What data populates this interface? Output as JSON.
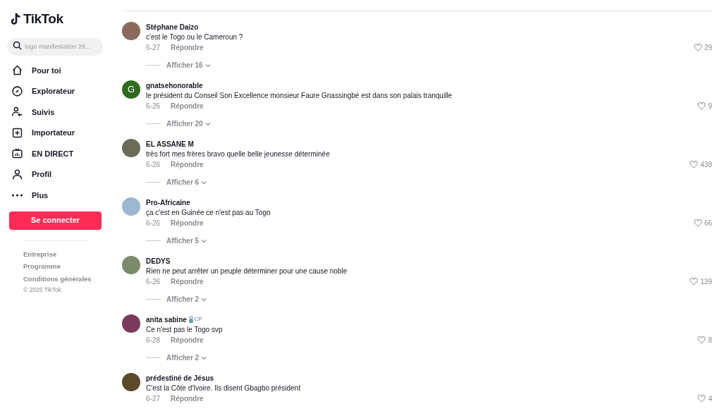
{
  "sidebar": {
    "logo": "TikTok",
    "search": {
      "placeholder": "togo manifestation 28..."
    },
    "nav": [
      {
        "label": "Pour toi"
      },
      {
        "label": "Explorateur"
      },
      {
        "label": "Suivis"
      },
      {
        "label": "Importateur"
      },
      {
        "label": "EN DIRECT"
      },
      {
        "label": "Profil"
      },
      {
        "label": "Plus"
      }
    ],
    "login_button": "Se connecter",
    "footer_links": [
      "Entreprise",
      "Programme",
      "Conditions générales"
    ],
    "copyright": "© 2025 TikTok"
  },
  "comments": [
    {
      "author": "Stéphane Daizo",
      "avatar": {
        "kind": "photo",
        "color": "#8a6a5a"
      },
      "text": "c'est le Togo ou le Cameroun ?",
      "date": "6-27",
      "reply": "Répondre",
      "likes": "29",
      "replies": "Afficher 16"
    },
    {
      "author": "gnatsehonorable",
      "avatar": {
        "kind": "letter",
        "letter": "G",
        "color": "#2e6b1f"
      },
      "text": "le président du Conseil Son Excellence monsieur Faure Gnassingbé est dans son palais tranquille",
      "date": "6-26",
      "reply": "Répondre",
      "likes": "9",
      "replies": "Afficher 20"
    },
    {
      "author": "EL ASSANE M",
      "avatar": {
        "kind": "photo",
        "color": "#6b6b5a"
      },
      "text": "très fort mes frères bravo quelle belle jeunesse déterminée",
      "date": "6-26",
      "reply": "Répondre",
      "likes": "438",
      "replies": "Afficher 6"
    },
    {
      "author": "Pro-Africaine",
      "avatar": {
        "kind": "photo",
        "color": "#9bb8d0"
      },
      "text": "ça c'est en Guinée ce n'est pas au Togo",
      "date": "6-26",
      "reply": "Répondre",
      "likes": "66",
      "replies": "Afficher 5"
    },
    {
      "author": "DEDYS",
      "avatar": {
        "kind": "photo",
        "color": "#7a8a6a"
      },
      "text": "Rien ne peut arrêter un peuple déterminer pour une cause noble",
      "date": "6-26",
      "reply": "Répondre",
      "likes": "139",
      "replies": "Afficher 2"
    },
    {
      "author": "anita sabine",
      "badge": "CP",
      "avatar": {
        "kind": "photo",
        "color": "#7a3a5a"
      },
      "text": "Ce n'est pas le Togo svp",
      "date": "6-28",
      "reply": "Répondre",
      "likes": "8",
      "replies": "Afficher 2"
    },
    {
      "author": "prédestiné de Jésus",
      "avatar": {
        "kind": "photo",
        "color": "#5a4a2a"
      },
      "text": "C'est la Côte d'Ivoire. Ils disent Gbagbo président",
      "date": "6-27",
      "reply": "Répondre",
      "likes": "4"
    }
  ]
}
